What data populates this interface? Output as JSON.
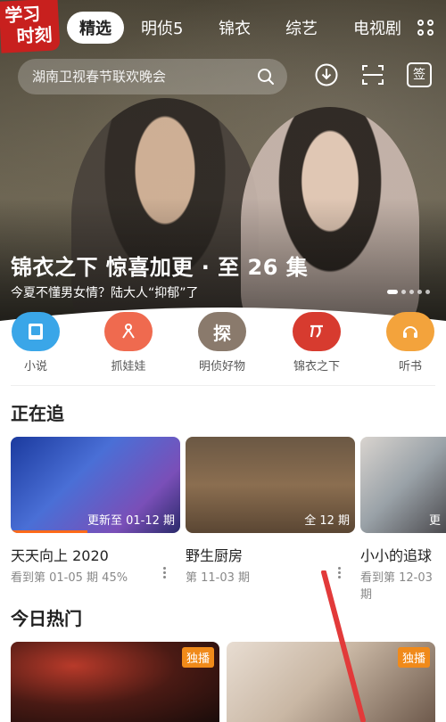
{
  "logo": {
    "line1": "学习",
    "line2": "时刻"
  },
  "tabs": [
    "精选",
    "明侦5",
    "锦衣",
    "综艺",
    "电视剧"
  ],
  "search": {
    "placeholder": "湖南卫视春节联欢晚会"
  },
  "icons": {
    "search": "search-icon",
    "download": "download-icon",
    "scan": "scan-icon",
    "checkin": "checkin-icon",
    "grid": "grid-menu-icon"
  },
  "checkin_glyph": "签",
  "hero": {
    "title": "锦衣之下 惊喜加更 · 至 26 集",
    "subtitle": "今夏不懂男女情？陆大人“抑郁”了"
  },
  "shortcuts": [
    {
      "label": "小说",
      "glyph": "",
      "color": "#3aa6e8"
    },
    {
      "label": "抓娃娃",
      "glyph": "",
      "color": "#ef6a4f"
    },
    {
      "label": "明侦好物",
      "glyph": "探",
      "color": "#8a7a6c"
    },
    {
      "label": "锦衣之下",
      "glyph": "",
      "color": "#d73b2f"
    },
    {
      "label": "听书",
      "glyph": "",
      "color": "#f3a33c"
    }
  ],
  "watching": {
    "title": "正在追",
    "items": [
      {
        "title": "天天向上 2020",
        "tag": "更新至 01-12 期",
        "sub": "看到第 01-05 期 45%",
        "progress": 0.45
      },
      {
        "title": "野生厨房",
        "tag": "全 12 期",
        "sub": "第 11-03 期",
        "progress": 0
      },
      {
        "title": "小小的追球",
        "tag": "更",
        "sub": "看到第 12-03 期",
        "progress": 0
      }
    ]
  },
  "hot": {
    "title": "今日热门",
    "badges": [
      "独播",
      "独播"
    ]
  },
  "colors": {
    "accent": "#ff6a1a",
    "badge": "#f08a1a",
    "logo": "#c8201e"
  }
}
